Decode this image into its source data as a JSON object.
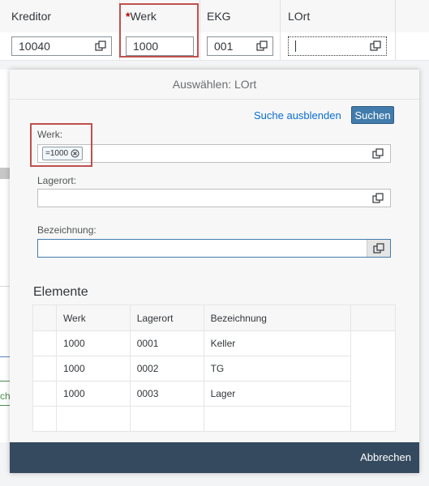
{
  "background_table": {
    "columns": [
      {
        "label": "Kreditor",
        "required": false
      },
      {
        "label": "Werk",
        "required": true
      },
      {
        "label": "EKG",
        "required": false
      },
      {
        "label": "LOrt",
        "required": false
      }
    ],
    "row": {
      "kreditor": "10040",
      "werk": "1000",
      "ekg": "001",
      "lort": ""
    },
    "required_marker": "*",
    "partial_left_text": "ch"
  },
  "dialog": {
    "title": "Auswählen: LOrt",
    "toolbar": {
      "hide_search_link": "Suche ausblenden",
      "search_button": "Suchen"
    },
    "fields": {
      "werk": {
        "label": "Werk:",
        "token": "=1000"
      },
      "lagerort": {
        "label": "Lagerort:",
        "value": ""
      },
      "bezeichnung": {
        "label": "Bezeichnung:",
        "value": ""
      }
    },
    "results": {
      "title": "Elemente",
      "headers": [
        "Werk",
        "Lagerort",
        "Bezeichnung"
      ],
      "rows": [
        [
          "1000",
          "0001",
          "Keller"
        ],
        [
          "1000",
          "0002",
          "TG"
        ],
        [
          "1000",
          "0003",
          "Lager"
        ]
      ]
    },
    "footer": {
      "cancel_button": "Abbrechen"
    }
  },
  "colors": {
    "accent": "#427cac",
    "link": "#0a6ed1",
    "highlight": "#c0504d",
    "footer": "#354a5f",
    "required": "#bb0000"
  }
}
